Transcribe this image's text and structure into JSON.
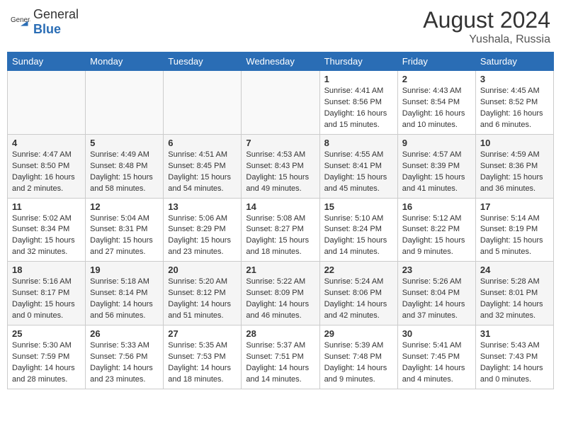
{
  "header": {
    "logo": {
      "general": "General",
      "blue": "Blue"
    },
    "title": "August 2024",
    "location": "Yushala, Russia"
  },
  "weekdays": [
    "Sunday",
    "Monday",
    "Tuesday",
    "Wednesday",
    "Thursday",
    "Friday",
    "Saturday"
  ],
  "weeks": [
    [
      {
        "day": "",
        "empty": true
      },
      {
        "day": "",
        "empty": true
      },
      {
        "day": "",
        "empty": true
      },
      {
        "day": "",
        "empty": true
      },
      {
        "day": "1",
        "sunrise": "4:41 AM",
        "sunset": "8:56 PM",
        "daylight": "16 hours and 15 minutes."
      },
      {
        "day": "2",
        "sunrise": "4:43 AM",
        "sunset": "8:54 PM",
        "daylight": "16 hours and 10 minutes."
      },
      {
        "day": "3",
        "sunrise": "4:45 AM",
        "sunset": "8:52 PM",
        "daylight": "16 hours and 6 minutes."
      }
    ],
    [
      {
        "day": "4",
        "sunrise": "4:47 AM",
        "sunset": "8:50 PM",
        "daylight": "16 hours and 2 minutes."
      },
      {
        "day": "5",
        "sunrise": "4:49 AM",
        "sunset": "8:48 PM",
        "daylight": "15 hours and 58 minutes."
      },
      {
        "day": "6",
        "sunrise": "4:51 AM",
        "sunset": "8:45 PM",
        "daylight": "15 hours and 54 minutes."
      },
      {
        "day": "7",
        "sunrise": "4:53 AM",
        "sunset": "8:43 PM",
        "daylight": "15 hours and 49 minutes."
      },
      {
        "day": "8",
        "sunrise": "4:55 AM",
        "sunset": "8:41 PM",
        "daylight": "15 hours and 45 minutes."
      },
      {
        "day": "9",
        "sunrise": "4:57 AM",
        "sunset": "8:39 PM",
        "daylight": "15 hours and 41 minutes."
      },
      {
        "day": "10",
        "sunrise": "4:59 AM",
        "sunset": "8:36 PM",
        "daylight": "15 hours and 36 minutes."
      }
    ],
    [
      {
        "day": "11",
        "sunrise": "5:02 AM",
        "sunset": "8:34 PM",
        "daylight": "15 hours and 32 minutes."
      },
      {
        "day": "12",
        "sunrise": "5:04 AM",
        "sunset": "8:31 PM",
        "daylight": "15 hours and 27 minutes."
      },
      {
        "day": "13",
        "sunrise": "5:06 AM",
        "sunset": "8:29 PM",
        "daylight": "15 hours and 23 minutes."
      },
      {
        "day": "14",
        "sunrise": "5:08 AM",
        "sunset": "8:27 PM",
        "daylight": "15 hours and 18 minutes."
      },
      {
        "day": "15",
        "sunrise": "5:10 AM",
        "sunset": "8:24 PM",
        "daylight": "15 hours and 14 minutes."
      },
      {
        "day": "16",
        "sunrise": "5:12 AM",
        "sunset": "8:22 PM",
        "daylight": "15 hours and 9 minutes."
      },
      {
        "day": "17",
        "sunrise": "5:14 AM",
        "sunset": "8:19 PM",
        "daylight": "15 hours and 5 minutes."
      }
    ],
    [
      {
        "day": "18",
        "sunrise": "5:16 AM",
        "sunset": "8:17 PM",
        "daylight": "15 hours and 0 minutes."
      },
      {
        "day": "19",
        "sunrise": "5:18 AM",
        "sunset": "8:14 PM",
        "daylight": "14 hours and 56 minutes."
      },
      {
        "day": "20",
        "sunrise": "5:20 AM",
        "sunset": "8:12 PM",
        "daylight": "14 hours and 51 minutes."
      },
      {
        "day": "21",
        "sunrise": "5:22 AM",
        "sunset": "8:09 PM",
        "daylight": "14 hours and 46 minutes."
      },
      {
        "day": "22",
        "sunrise": "5:24 AM",
        "sunset": "8:06 PM",
        "daylight": "14 hours and 42 minutes."
      },
      {
        "day": "23",
        "sunrise": "5:26 AM",
        "sunset": "8:04 PM",
        "daylight": "14 hours and 37 minutes."
      },
      {
        "day": "24",
        "sunrise": "5:28 AM",
        "sunset": "8:01 PM",
        "daylight": "14 hours and 32 minutes."
      }
    ],
    [
      {
        "day": "25",
        "sunrise": "5:30 AM",
        "sunset": "7:59 PM",
        "daylight": "14 hours and 28 minutes."
      },
      {
        "day": "26",
        "sunrise": "5:33 AM",
        "sunset": "7:56 PM",
        "daylight": "14 hours and 23 minutes."
      },
      {
        "day": "27",
        "sunrise": "5:35 AM",
        "sunset": "7:53 PM",
        "daylight": "14 hours and 18 minutes."
      },
      {
        "day": "28",
        "sunrise": "5:37 AM",
        "sunset": "7:51 PM",
        "daylight": "14 hours and 14 minutes."
      },
      {
        "day": "29",
        "sunrise": "5:39 AM",
        "sunset": "7:48 PM",
        "daylight": "14 hours and 9 minutes."
      },
      {
        "day": "30",
        "sunrise": "5:41 AM",
        "sunset": "7:45 PM",
        "daylight": "14 hours and 4 minutes."
      },
      {
        "day": "31",
        "sunrise": "5:43 AM",
        "sunset": "7:43 PM",
        "daylight": "14 hours and 0 minutes."
      }
    ]
  ]
}
